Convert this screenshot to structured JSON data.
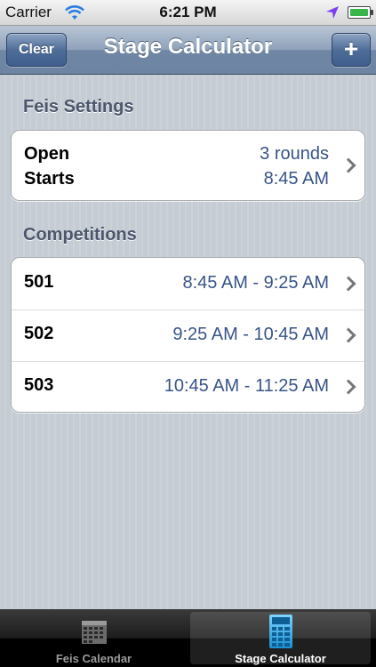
{
  "status_bar": {
    "carrier": "Carrier",
    "time": "6:21 PM",
    "icons": [
      "wifi-icon",
      "location-arrow-icon",
      "battery-icon"
    ],
    "location_color": "#7b3ff2",
    "battery_color": "#39b54a"
  },
  "nav": {
    "title": "Stage Calculator",
    "left_button": "Clear",
    "right_button": "+"
  },
  "feis_settings": {
    "header": "Feis Settings",
    "rows": [
      {
        "label": "Open",
        "value": "3 rounds"
      },
      {
        "label": "Starts",
        "value": "8:45 AM"
      }
    ]
  },
  "competitions": {
    "header": "Competitions",
    "rows": [
      {
        "number": "501",
        "range": "8:45 AM - 9:25 AM"
      },
      {
        "number": "502",
        "range": "9:25 AM - 10:45 AM"
      },
      {
        "number": "503",
        "range": "10:45 AM - 11:25 AM"
      }
    ]
  },
  "tab_bar": {
    "tabs": [
      {
        "label": "Feis Calendar",
        "icon": "calendar-icon",
        "selected": false
      },
      {
        "label": "Stage Calculator",
        "icon": "calculator-icon",
        "selected": true
      }
    ]
  },
  "colors": {
    "value_text": "#385487",
    "nav_tint": "#6d84a2",
    "accent_icon": "#2a9fd6"
  }
}
